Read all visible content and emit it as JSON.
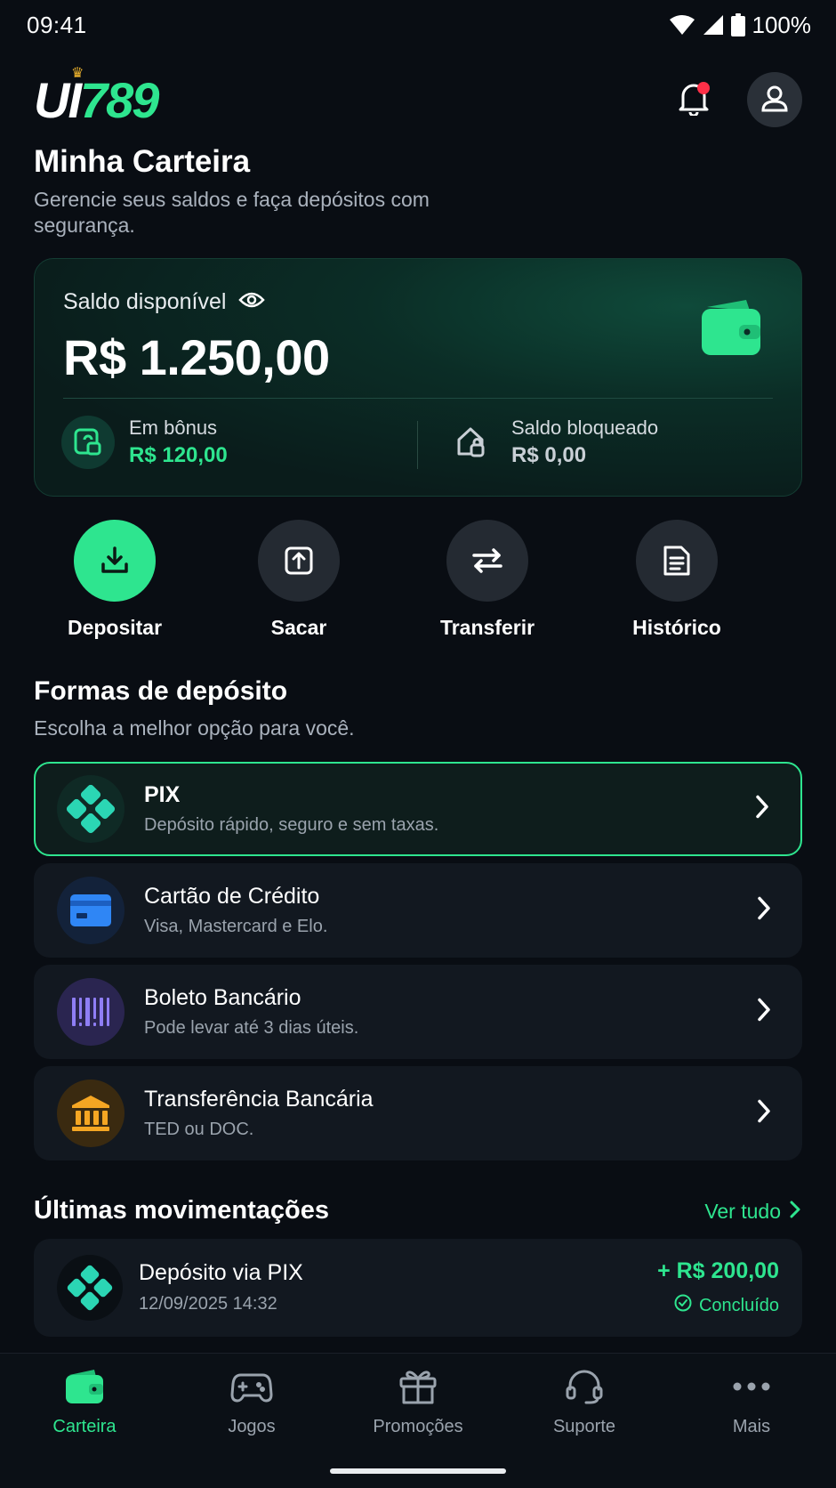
{
  "status_bar": {
    "time": "09:41",
    "battery": "100%"
  },
  "header": {
    "logo_white": "UI",
    "logo_green": "789",
    "crown": "♛"
  },
  "page": {
    "title": "Minha Carteira",
    "subtitle": "Gerencie seus saldos e faça depósitos com segurança."
  },
  "balance": {
    "label": "Saldo disponível",
    "value": "R$ 1.250,00",
    "bonus_label": "Em bônus",
    "bonus_value": "R$ 120,00",
    "blocked_label": "Saldo bloqueado",
    "blocked_value": "R$ 0,00"
  },
  "actions": [
    {
      "label": "Depositar",
      "icon": "download-icon"
    },
    {
      "label": "Sacar",
      "icon": "upload-icon"
    },
    {
      "label": "Transferir",
      "icon": "transfer-icon"
    },
    {
      "label": "Histórico",
      "icon": "history-icon"
    }
  ],
  "deposit_methods": {
    "title": "Formas de depósito",
    "subtitle": "Escolha a melhor opção para você.",
    "items": [
      {
        "title": "PIX",
        "desc": "Depósito rápido, seguro e sem taxas.",
        "icon": "pix-icon"
      },
      {
        "title": "Cartão de Crédito",
        "desc": "Visa, Mastercard e Elo.",
        "icon": "credit-card-icon"
      },
      {
        "title": "Boleto Bancário",
        "desc": "Pode levar até 3 dias úteis.",
        "icon": "barcode-icon"
      },
      {
        "title": "Transferência Bancária",
        "desc": "TED ou DOC.",
        "icon": "bank-icon"
      }
    ]
  },
  "movements": {
    "title": "Últimas movimentações",
    "see_all": "Ver tudo",
    "items": [
      {
        "name": "Depósito via PIX",
        "date": "12/09/2025 14:32",
        "amount": "+ R$ 200,00",
        "status": "Concluído"
      }
    ]
  },
  "bottom_nav": [
    {
      "label": "Carteira",
      "icon": "wallet-icon",
      "active": true
    },
    {
      "label": "Jogos",
      "icon": "gamepad-icon",
      "active": false
    },
    {
      "label": "Promoções",
      "icon": "gift-icon",
      "active": false
    },
    {
      "label": "Suporte",
      "icon": "headset-icon",
      "active": false
    },
    {
      "label": "Mais",
      "icon": "more-icon",
      "active": false
    }
  ],
  "colors": {
    "accent": "#2ee58f",
    "background": "#090d13",
    "card": "#121820"
  }
}
